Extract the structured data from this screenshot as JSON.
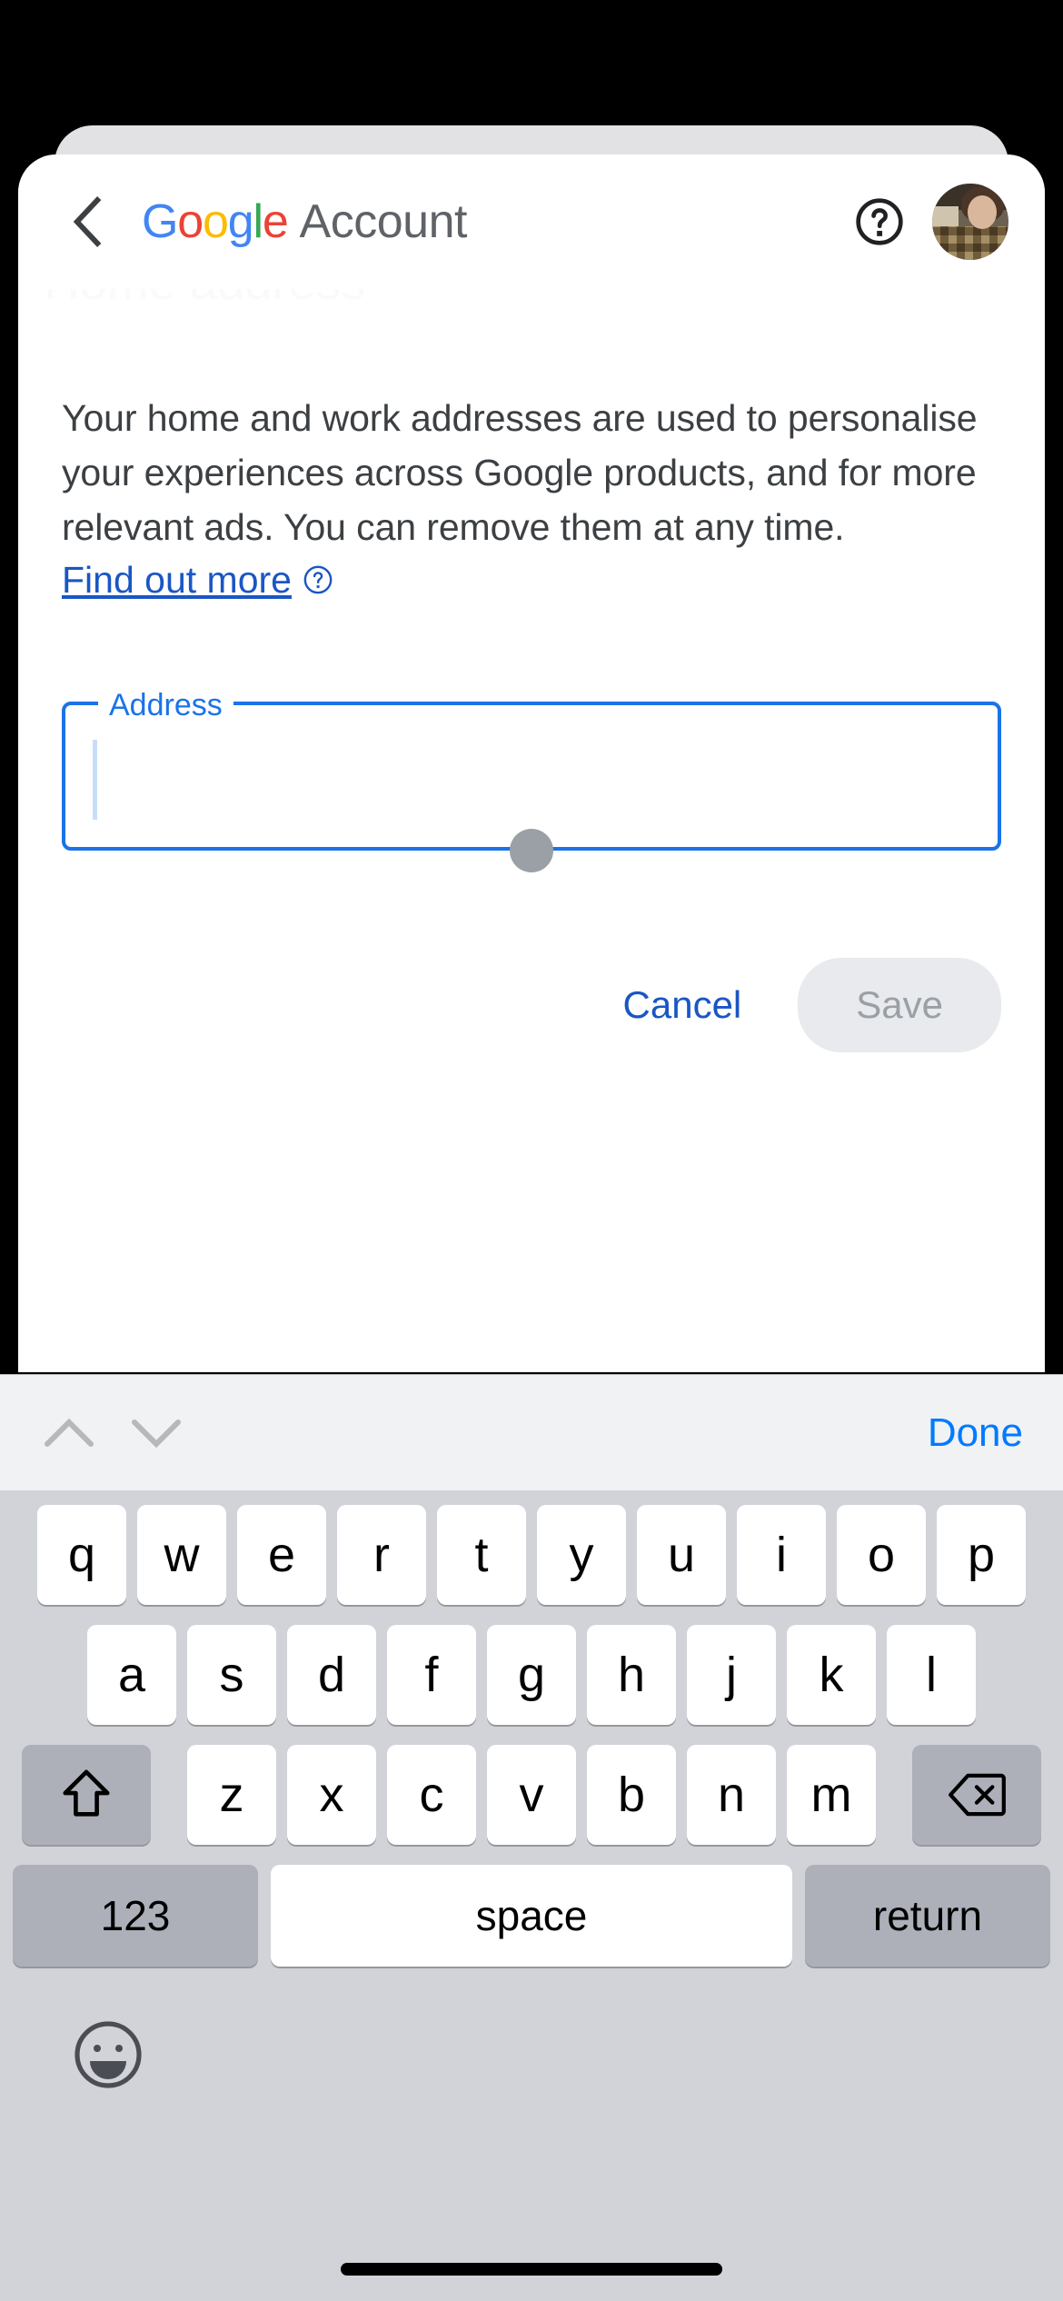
{
  "app": {
    "brand_parts": [
      {
        "ch": "G",
        "color": "blue"
      },
      {
        "ch": "o",
        "color": "red"
      },
      {
        "ch": "o",
        "color": "yellow"
      },
      {
        "ch": "g",
        "color": "blue"
      },
      {
        "ch": "l",
        "color": "green"
      },
      {
        "ch": "e",
        "color": "red"
      }
    ],
    "brand_text": "Google",
    "account_word": "Account",
    "ghost_title": "Home address",
    "back_icon": "chevron-left-icon",
    "help_icon": "help-circle-icon",
    "avatar_icon": "user-avatar"
  },
  "main": {
    "description": "Your home and work addresses are used to personalise your experiences across Google products, and for more relevant ads. You can remove them at any time.",
    "find_out_more": "Find out more",
    "find_out_more_icon": "help-circle-icon",
    "field": {
      "label": "Address",
      "value": "",
      "placeholder": "",
      "focused": true
    },
    "cancel_label": "Cancel",
    "save_label": "Save",
    "save_disabled": true
  },
  "accessory_bar": {
    "prev_icon": "chevron-up-icon",
    "next_icon": "chevron-down-icon",
    "done_label": "Done"
  },
  "keyboard": {
    "row1": [
      "q",
      "w",
      "e",
      "r",
      "t",
      "y",
      "u",
      "i",
      "o",
      "p"
    ],
    "row2": [
      "a",
      "s",
      "d",
      "f",
      "g",
      "h",
      "j",
      "k",
      "l"
    ],
    "row3": [
      "z",
      "x",
      "c",
      "v",
      "b",
      "n",
      "m"
    ],
    "shift_icon": "shift-arrow-icon",
    "backspace_icon": "backspace-icon",
    "numbers_label": "123",
    "space_label": "space",
    "return_label": "return",
    "emoji_icon": "emoji-smiley-icon"
  },
  "colors": {
    "google_blue": "#4285F4",
    "google_red": "#EA4335",
    "google_yellow": "#FBBC05",
    "google_green": "#34A853",
    "link_blue": "#1a56c4",
    "field_blue": "#1a73e8",
    "ios_blue": "#007aff",
    "keyboard_bg": "#d1d3d9"
  }
}
